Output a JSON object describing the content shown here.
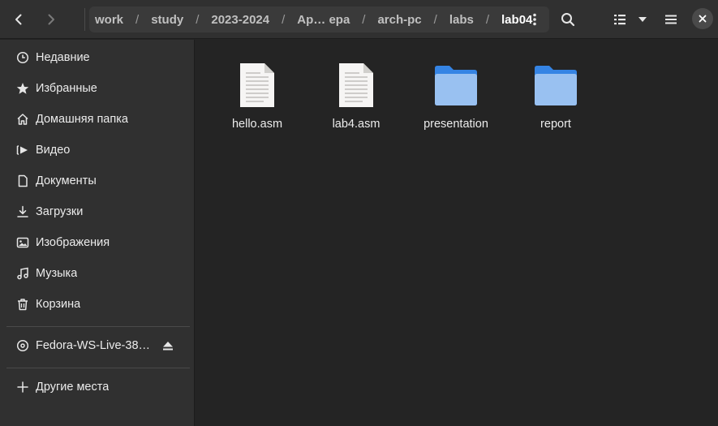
{
  "header": {
    "back_icon": "chevron-left-icon",
    "forward_icon": "chevron-right-icon",
    "breadcrumbs": [
      "work",
      "study",
      "2023-2024",
      "Ар… ера",
      "arch-pc",
      "labs",
      "lab04"
    ],
    "separator": "/",
    "path_menu_icon": "vertical-dots-icon",
    "search_icon": "search-icon",
    "view_icon": "list-view-icon",
    "view_dropdown_icon": "triangle-down-icon",
    "menu_icon": "hamburger-menu-icon",
    "close_icon": "close-icon"
  },
  "sidebar": {
    "places": [
      {
        "label": "Недавние",
        "icon": "clock-icon"
      },
      {
        "label": "Избранные",
        "icon": "star-icon"
      },
      {
        "label": "Домашняя папка",
        "icon": "home-icon"
      },
      {
        "label": "Видео",
        "icon": "video-icon"
      },
      {
        "label": "Документы",
        "icon": "document-icon"
      },
      {
        "label": "Загрузки",
        "icon": "download-icon"
      },
      {
        "label": "Изображения",
        "icon": "image-icon"
      },
      {
        "label": "Музыка",
        "icon": "music-icon"
      },
      {
        "label": "Корзина",
        "icon": "trash-icon"
      }
    ],
    "device": {
      "label": "Fedora-WS-Live-38…",
      "icon": "disc-icon",
      "eject_icon": "eject-icon"
    },
    "other": {
      "label": "Другие места",
      "icon": "plus-icon"
    }
  },
  "files": [
    {
      "name": "hello.asm",
      "type": "text-file"
    },
    {
      "name": "lab4.asm",
      "type": "text-file"
    },
    {
      "name": "presentation",
      "type": "folder"
    },
    {
      "name": "report",
      "type": "folder"
    }
  ],
  "colors": {
    "folder": "#99c1f1",
    "folder_tab": "#3584e4",
    "background": "#242424",
    "sidebar": "#303030"
  }
}
